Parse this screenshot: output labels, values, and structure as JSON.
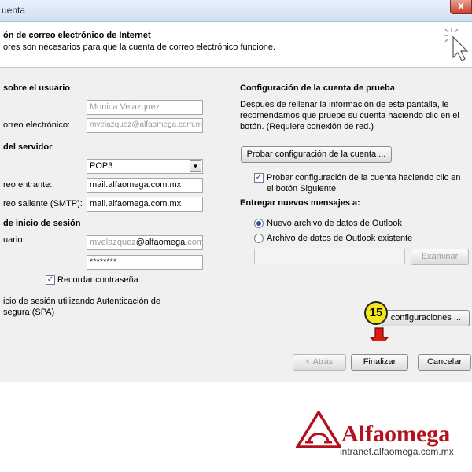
{
  "window": {
    "title": "uenta",
    "close_label": "X"
  },
  "header": {
    "title": "ón de correo electrónico de Internet",
    "subtitle": "ores son necesarios para que la cuenta de correo electrónico funcione."
  },
  "user_info": {
    "section": "sobre el usuario",
    "name_value": "Monica Velazquez",
    "email_label": "orreo electrónico:",
    "email_value": "mvelazquez@alfaomega.com.mx"
  },
  "server_info": {
    "section": " del servidor",
    "account_type_value": "POP3",
    "incoming_label": "reo entrante:",
    "incoming_value": "mail.alfaomega.com.mx",
    "outgoing_label": "reo saliente (SMTP):",
    "outgoing_value": "mail.alfaomega.com.mx"
  },
  "logon_info": {
    "section": "de inicio de sesión",
    "user_label": "uario:",
    "user_value_prefix": "mvelazquez",
    "user_value_domain": "@alfaomega.",
    "user_value_suffix": "com.mx",
    "password_value": "********",
    "remember_label": "Recordar contraseña",
    "spa_line1": "icio de sesión utilizando Autenticación de",
    "spa_line2": "segura (SPA)"
  },
  "test_settings": {
    "section": "Configuración de la cuenta de prueba",
    "desc_line1": "Después de rellenar la información de esta pantalla, le",
    "desc_line2": "recomendamos que pruebe su cuenta haciendo clic en el",
    "desc_line3": "botón. (Requiere conexión de red.)",
    "test_button": "Probar configuración de la cuenta ...",
    "test_next_line1": "Probar configuración de la cuenta haciendo clic en",
    "test_next_line2": "el botón Siguiente"
  },
  "deliver": {
    "section": "Entregar nuevos mensajes a:",
    "option_new": "Nuevo archivo de datos de Outlook",
    "option_existing": "Archivo de datos de Outlook existente",
    "browse_button": "Examinar"
  },
  "more_settings_button": "configuraciones ...",
  "footer": {
    "back_button": "< Atrás",
    "finish_button": "Finalizar",
    "cancel_button": "Cancelar"
  },
  "callout": {
    "step": "15"
  },
  "branding": {
    "name": "Alfaomega",
    "url": "intranet.alfaomega.com.mx",
    "color": "#b3111d"
  }
}
